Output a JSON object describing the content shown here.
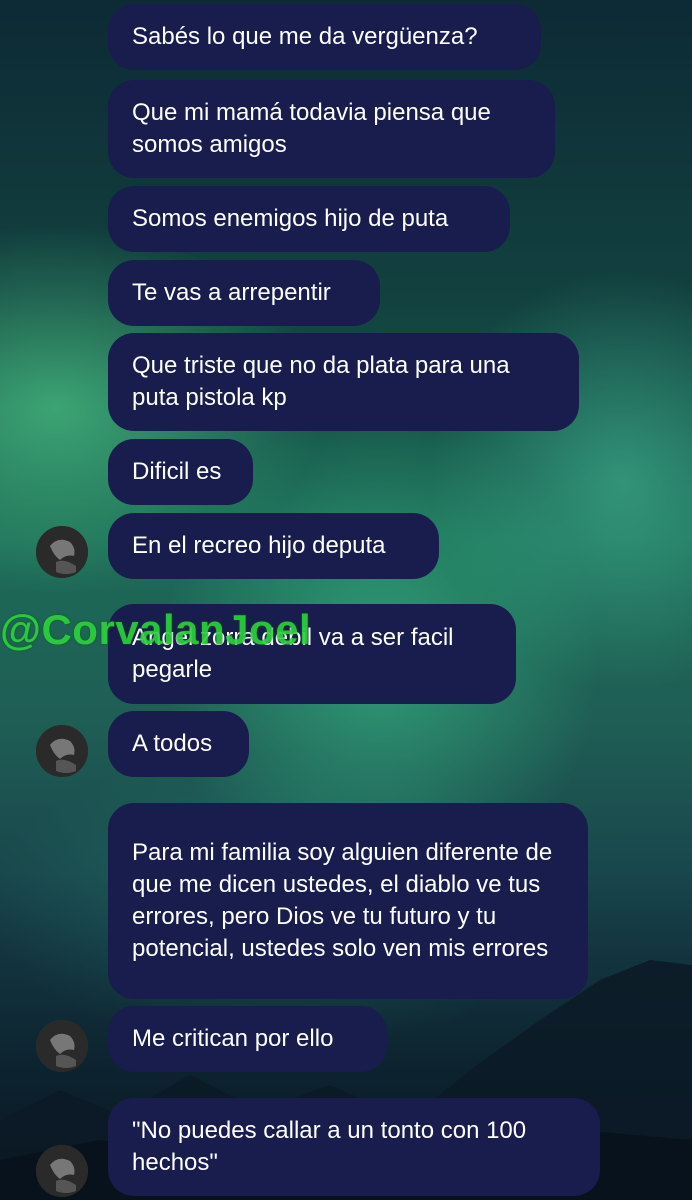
{
  "messages": [
    {
      "text": "Sabés lo que me da vergüenza?"
    },
    {
      "text": "Que mi mamá todavia piensa que somos amigos"
    },
    {
      "text": "Somos enemigos hijo de puta"
    },
    {
      "text": "Te vas a arrepentir"
    },
    {
      "text": "Que triste que no da plata para una puta pistola kp"
    },
    {
      "text": "Dificil es"
    },
    {
      "text": "En el recreo hijo deputa"
    },
    {
      "text": "Angel zorra debil va a ser facil pegarle"
    },
    {
      "text": "A todos"
    },
    {
      "text": "Para mi familia soy alguien diferente de que me dicen ustedes, el diablo ve tus errores, pero Dios ve tu futuro y tu potencial, ustedes solo ven mis errores"
    },
    {
      "text": "Me critican por ello"
    },
    {
      "text": "\"No puedes callar a un tonto con 100 hechos\""
    }
  ],
  "watermark": "@CorvalanJoel",
  "icons": {
    "avatar": "user-avatar-icon"
  },
  "colors": {
    "bubble": "#181d4d",
    "text": "#ffffff",
    "watermark": "#2bd13c"
  }
}
